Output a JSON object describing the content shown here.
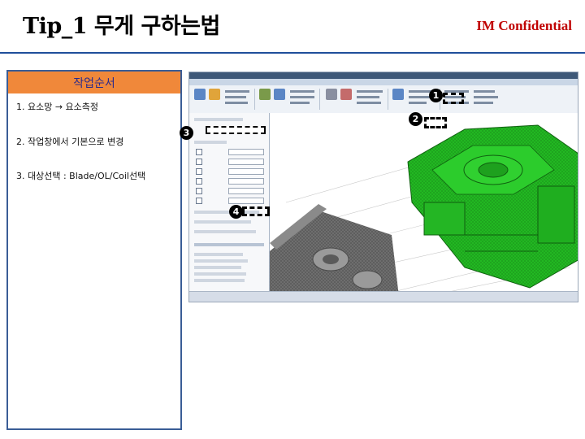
{
  "header": {
    "title": "Tip_1 무게 구하는법",
    "confidential": "IM Confidential"
  },
  "panel": {
    "heading": "작업순서",
    "steps": [
      "1. 요소망 → 요소측정",
      "2. 작업창에서 기본으로 변경",
      "3. 대상선택 : Blade/OL/Coil선택"
    ]
  },
  "markers": [
    "1",
    "2",
    "3",
    "4"
  ],
  "colors": {
    "accent_orange": "#f0883a",
    "heading_text": "#2b2b8c",
    "panel_border": "#3a5d96",
    "confidential_red": "#c00000",
    "mesh_green": "#22b822",
    "mesh_gray": "#6e6e6e"
  }
}
